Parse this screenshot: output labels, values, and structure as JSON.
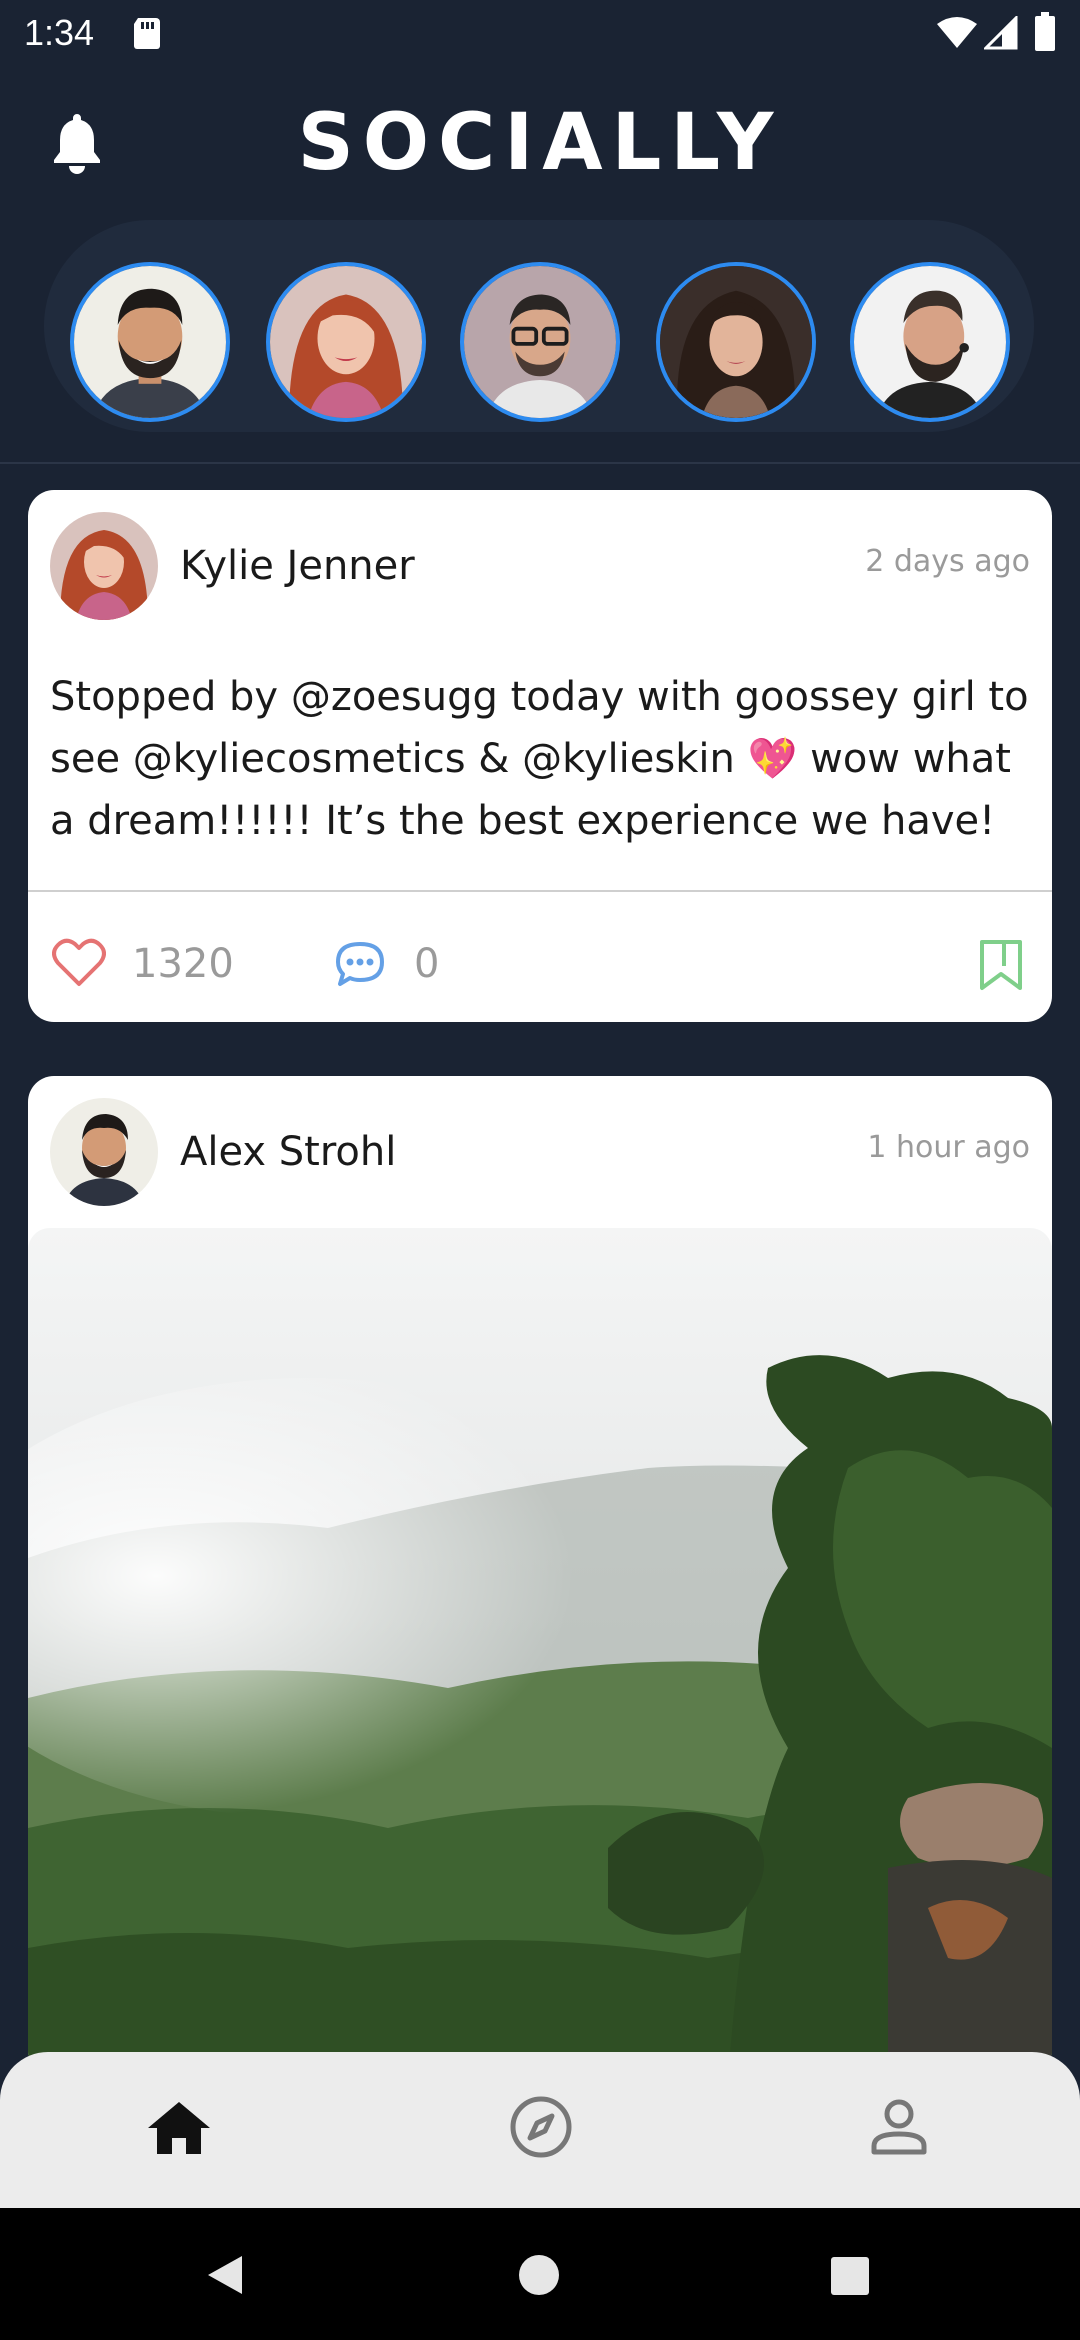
{
  "status_bar": {
    "time": "1:34",
    "icons": [
      "sd-card-icon",
      "wifi-icon",
      "signal-icon",
      "battery-icon"
    ]
  },
  "header": {
    "title": "SOCIALLY",
    "notification_icon": "bell-icon"
  },
  "stories": [
    {
      "person": "man-beard-smiling",
      "ring_color": "#2d8bf0"
    },
    {
      "person": "woman-red-hair",
      "ring_color": "#2d8bf0"
    },
    {
      "person": "man-glasses",
      "ring_color": "#2d8bf0"
    },
    {
      "person": "woman-curly-hair",
      "ring_color": "#2d8bf0"
    },
    {
      "person": "man-beard-profile",
      "ring_color": "#2d8bf0"
    }
  ],
  "posts": [
    {
      "author": "Kylie Jenner",
      "time_ago": "2 days ago",
      "text": "Stopped by @zoesugg today with goossey girl to see @kyliecosmetics & @kylieskin 💖 wow what a dream!!!!!! It’s the best experience we have!",
      "likes": "1320",
      "comments": "0",
      "icons": [
        "heart-icon",
        "comment-icon",
        "bookmark-icon"
      ]
    },
    {
      "author": "Alex Strohl",
      "time_ago": "1 hour ago",
      "image": "misty-forest-mountain-photo"
    }
  ],
  "bottom_nav": {
    "items": [
      "home",
      "explore",
      "profile"
    ],
    "active": "home"
  },
  "colors": {
    "background": "#1a2333",
    "story_ring": "#2d8bf0",
    "like": "#e57373",
    "comment": "#64a0e6",
    "bookmark": "#7fcf8a",
    "muted_text": "#9a9a9a",
    "nav_bg": "#ececec"
  }
}
